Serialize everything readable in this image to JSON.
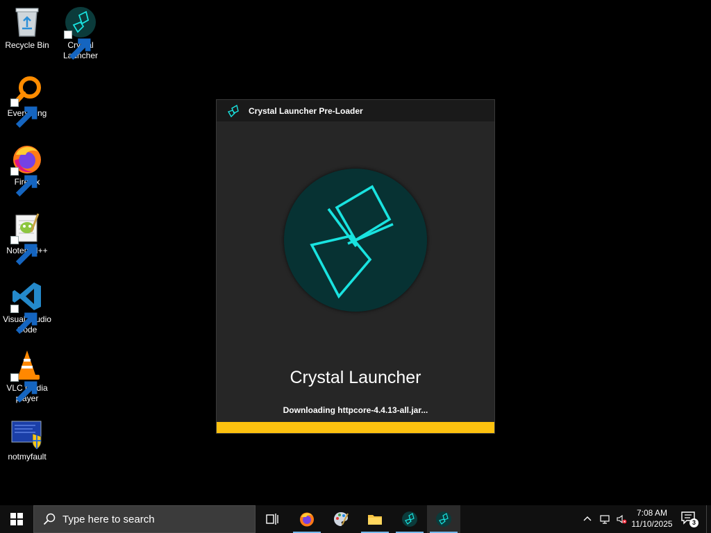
{
  "desktop": {
    "icons": [
      {
        "label": "Recycle Bin",
        "icon": "recycle-bin-icon"
      },
      {
        "label": "Crystal Launcher",
        "icon": "crystal-launcher-icon"
      },
      {
        "label": "Everything",
        "icon": "everything-search-icon"
      },
      {
        "label": "Firefox",
        "icon": "firefox-icon"
      },
      {
        "label": "Notepad++",
        "icon": "notepad-plus-plus-icon"
      },
      {
        "label": "Visual Studio Code",
        "icon": "vscode-icon"
      },
      {
        "label": "VLC media player",
        "icon": "vlc-icon"
      },
      {
        "label": "notmyfault",
        "icon": "notmyfault-icon"
      }
    ]
  },
  "loader": {
    "title": "Crystal Launcher Pre-Loader",
    "app_name": "Crystal Launcher",
    "status": "Downloading httpcore-4.4.13-all.jar...",
    "progress": 1.0,
    "colors": {
      "accent": "#fcc10f",
      "logo_bg": "#073233",
      "logo_stroke": "#19e3e0"
    }
  },
  "taskbar": {
    "search_placeholder": "Type here to search",
    "clock_time": "7:08 AM",
    "clock_date": "11/10/2025",
    "notification_count": "3",
    "apps": [
      {
        "name": "Task View",
        "icon": "task-view-icon"
      },
      {
        "name": "Firefox",
        "icon": "firefox-icon"
      },
      {
        "name": "Paint",
        "icon": "paint-palette-icon"
      },
      {
        "name": "File Explorer",
        "icon": "folder-icon"
      },
      {
        "name": "Crystal Launcher",
        "icon": "crystal-launcher-icon"
      },
      {
        "name": "Crystal Launcher Pre-Loader",
        "icon": "crystal-launcher-icon"
      }
    ]
  }
}
